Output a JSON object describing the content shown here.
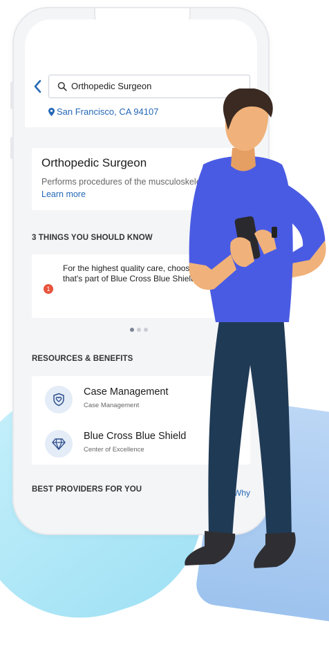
{
  "search": {
    "query": "Orthopedic Surgeon",
    "location": "San Francisco, CA 94107"
  },
  "specialty": {
    "title": "Orthopedic Surgeon",
    "description": "Performs procedures of the musculoskeletal system.",
    "learn_more": "Learn more"
  },
  "things_to_know": {
    "heading": "3 THINGS YOU SHOULD KNOW",
    "items": [
      {
        "number": "1",
        "text": "For the highest quality care, choose a facility that's part of Blue Cross Blue Shield COE."
      }
    ]
  },
  "resources": {
    "heading": "RESOURCES & BENEFITS",
    "items": [
      {
        "title": "Case Management",
        "subtitle": "Case Management",
        "icon": "heart-shield-icon"
      },
      {
        "title": "Blue Cross Blue Shield",
        "subtitle": "Center of Excellence",
        "icon": "diamond-icon"
      }
    ]
  },
  "providers": {
    "heading": "BEST PROVIDERS FOR YOU",
    "why_label": "Why"
  },
  "colors": {
    "accent": "#2468b6",
    "badge": "#e8533c",
    "shirt": "#4a5be3",
    "pants": "#1f3a55",
    "skin": "#f0b27a"
  }
}
